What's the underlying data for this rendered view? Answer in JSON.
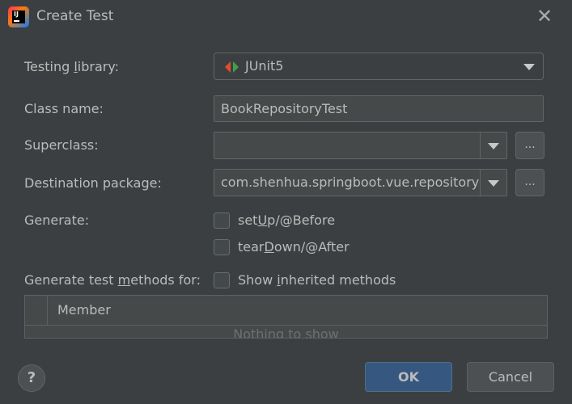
{
  "window": {
    "title": "Create Test",
    "icon": "intellij-idea-icon",
    "close_icon": "close-icon"
  },
  "form": {
    "testing_library": {
      "label_pre": "Testing ",
      "label_u": "l",
      "label_post": "ibrary:",
      "value": "JUnit5",
      "icon": "junit5-icon"
    },
    "class_name": {
      "label": "Class name:",
      "value": "BookRepositoryTest"
    },
    "superclass": {
      "label": "Superclass:",
      "value": "",
      "browse_label": "..."
    },
    "destination_package": {
      "label": "Destination package:",
      "value": "com.shenhua.springboot.vue.repository",
      "browse_label": "..."
    },
    "generate": {
      "label": "Generate:",
      "setup": {
        "pre": "set",
        "u": "U",
        "post": "p/@Before",
        "checked": false
      },
      "teardown": {
        "pre": "tear",
        "u": "D",
        "post": "own/@After",
        "checked": false
      }
    },
    "methods": {
      "label_pre": "Generate test ",
      "label_u": "m",
      "label_post": "ethods for:",
      "show_inherited": {
        "pre": "Show ",
        "u": "i",
        "post": "nherited methods",
        "checked": false
      }
    }
  },
  "table": {
    "header": "Member",
    "empty_text": "Nothing to show"
  },
  "footer": {
    "help_label": "?",
    "ok_label": "OK",
    "cancel_label": "Cancel"
  },
  "colors": {
    "background": "#3c3f41",
    "ok_button": "#365880",
    "text": "#bbbbbb"
  }
}
